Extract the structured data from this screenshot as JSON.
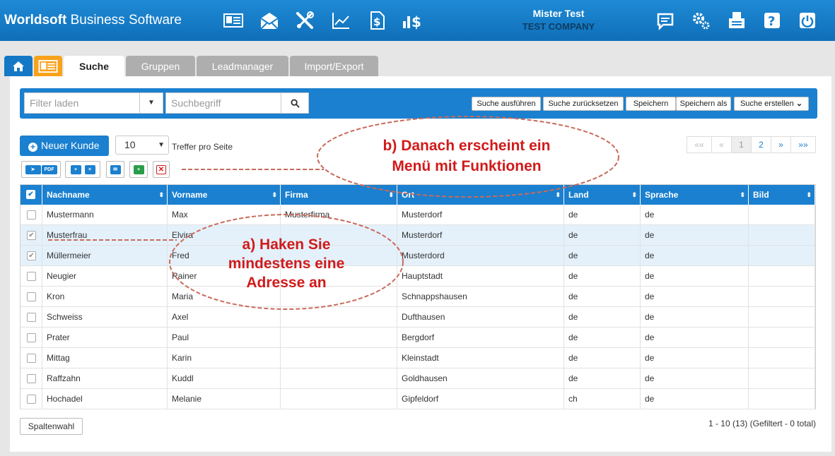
{
  "app": {
    "brand_bold": "Worldsoft",
    "brand_rest": " Business Software"
  },
  "nav_icons": [
    "contact-card-icon",
    "mail-envelope-icon",
    "tools-icon",
    "chart-line-icon",
    "document-dollar-icon",
    "bar-dollar-icon"
  ],
  "user": {
    "name": "Mister Test",
    "company": "TEST COMPANY"
  },
  "right_icons": [
    "message-icon",
    "gears-icon",
    "fax-icon",
    "help-icon",
    "power-icon"
  ],
  "tabs": [
    {
      "label": "Suche"
    },
    {
      "label": "Gruppen"
    },
    {
      "label": "Leadmanager"
    },
    {
      "label": "Import/Export"
    }
  ],
  "toolbar": {
    "filter_placeholder": "Filter laden",
    "search_placeholder": "Suchbegriff",
    "buttons": [
      "Suche ausführen",
      "Suche zurücksetzen",
      "Speichern",
      "Speichern als",
      "Suche erstellen"
    ]
  },
  "new_customer_label": "Neuer Kunde",
  "per_page": {
    "value": "10",
    "label": "Treffer pro Seite"
  },
  "pagination": [
    "««",
    "«",
    "1",
    "2",
    "»",
    "»»"
  ],
  "columns": [
    "Nachname",
    "Vorname",
    "Firma",
    "Ort",
    "Land",
    "Sprache",
    "Bild"
  ],
  "rows": [
    {
      "checked": false,
      "cells": [
        "Mustermann",
        "Max",
        "Musterfirma",
        "Musterdorf",
        "de",
        "de",
        ""
      ]
    },
    {
      "checked": true,
      "cells": [
        "Musterfrau",
        "Elvira",
        "",
        "Musterdorf",
        "de",
        "de",
        ""
      ]
    },
    {
      "checked": true,
      "cells": [
        "Müllermeier",
        "Fred",
        "",
        "Musterdord",
        "de",
        "de",
        ""
      ]
    },
    {
      "checked": false,
      "cells": [
        "Neugier",
        "Rainer",
        "",
        "Hauptstadt",
        "de",
        "de",
        ""
      ]
    },
    {
      "checked": false,
      "cells": [
        "Kron",
        "Maria",
        "",
        "Schnappshausen",
        "de",
        "de",
        ""
      ]
    },
    {
      "checked": false,
      "cells": [
        "Schweiss",
        "Axel",
        "",
        "Dufthausen",
        "de",
        "de",
        ""
      ]
    },
    {
      "checked": false,
      "cells": [
        "Prater",
        "Paul",
        "",
        "Bergdorf",
        "de",
        "de",
        ""
      ]
    },
    {
      "checked": false,
      "cells": [
        "Mittag",
        "Karin",
        "",
        "Kleinstadt",
        "de",
        "de",
        ""
      ]
    },
    {
      "checked": false,
      "cells": [
        "Raffzahn",
        "Kuddl",
        "",
        "Goldhausen",
        "de",
        "de",
        ""
      ]
    },
    {
      "checked": false,
      "cells": [
        "Hochadel",
        "Melanie",
        "",
        "Gipfeldorf",
        "ch",
        "de",
        ""
      ]
    }
  ],
  "spaltenwahl_label": "Spaltenwahl",
  "summary": "1 - 10 (13) (Gefiltert - 0 total)",
  "annotations": {
    "b_line1": "b) Danach erscheint ein",
    "b_line2": "Menü mit Funktionen",
    "a_line1": "a) Haken Sie",
    "a_line2": "mindestens eine",
    "a_line3": "Adresse an"
  },
  "colors": {
    "header_blue": "#1a80cf",
    "annotation_red": "#d11a1a",
    "selected_row": "#e4f1fb",
    "contacts_tab": "#f8a21b"
  }
}
